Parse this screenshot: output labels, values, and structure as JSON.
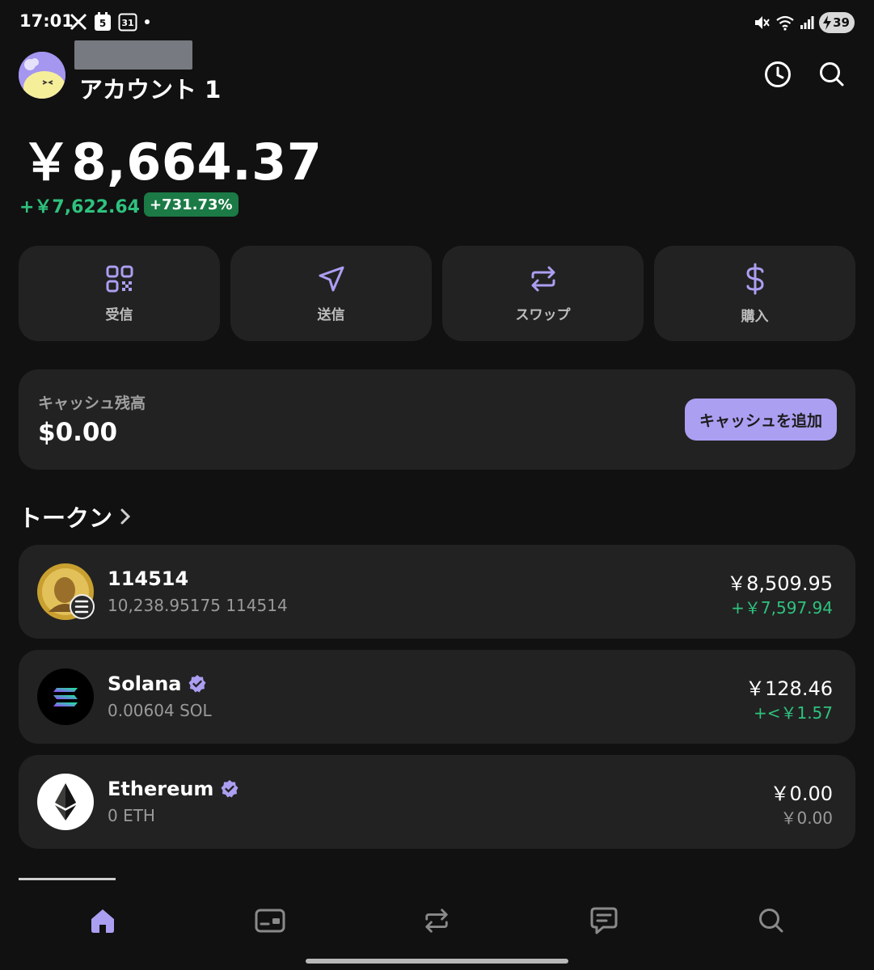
{
  "status_bar": {
    "time": "17:01",
    "calendar_day_1": "5",
    "calendar_day_2": "31",
    "battery": "39"
  },
  "header": {
    "account_name": "アカウント 1"
  },
  "balance": {
    "total": "￥8,664.37",
    "change": "+￥7,622.64",
    "change_percent": "+731.73%"
  },
  "actions": [
    {
      "label": "受信",
      "icon": "qr-code-icon"
    },
    {
      "label": "送信",
      "icon": "send-icon"
    },
    {
      "label": "スワップ",
      "icon": "swap-icon"
    },
    {
      "label": "購入",
      "icon": "dollar-icon"
    }
  ],
  "cash": {
    "label": "キャッシュ残高",
    "value": "$0.00",
    "add_button": "キャッシュを追加"
  },
  "tokens": {
    "title": "トークン",
    "items": [
      {
        "name": "114514",
        "amount": "10,238.95175 114514",
        "value": "￥8,509.95",
        "change": "+￥7,597.94",
        "verified": false
      },
      {
        "name": "Solana",
        "amount": "0.00604 SOL",
        "value": "￥128.46",
        "change": "+<￥1.57",
        "verified": true
      },
      {
        "name": "Ethereum",
        "amount": "0 ETH",
        "value": "￥0.00",
        "change": "￥0.00",
        "verified": true
      }
    ]
  },
  "colors": {
    "background": "#111111",
    "card": "#222222",
    "accent": "#ab9ff2",
    "positive": "#2ec27e"
  },
  "bottom_nav": [
    "home-icon",
    "wallet-card-icon",
    "swap-icon",
    "chat-icon",
    "search-icon"
  ]
}
